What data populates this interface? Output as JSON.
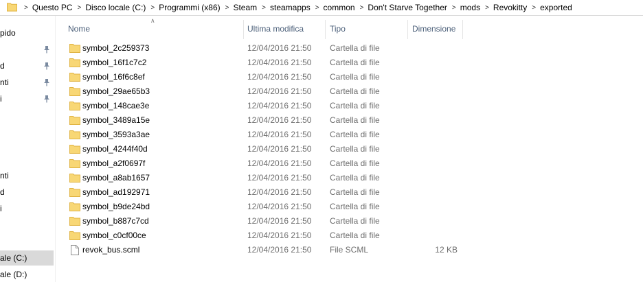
{
  "breadcrumb": [
    "Questo PC",
    "Disco locale (C:)",
    "Programmi (x86)",
    "Steam",
    "steamapps",
    "common",
    "Don't Starve Together",
    "mods",
    "Revokitty",
    "exported"
  ],
  "breadcrumb_separator": ">",
  "nav": {
    "items": [
      {
        "label": "pido",
        "pinned": false
      },
      {
        "label": "",
        "pinned": true
      },
      {
        "label": "d",
        "pinned": true
      },
      {
        "label": "nti",
        "pinned": true
      },
      {
        "label": "i",
        "pinned": true
      },
      {
        "label": "nti",
        "pinned": false
      },
      {
        "label": "d",
        "pinned": false
      },
      {
        "label": "i",
        "pinned": false
      },
      {
        "label": "ale (C:)",
        "pinned": false,
        "selected": true
      },
      {
        "label": "ale (D:)",
        "pinned": false
      }
    ]
  },
  "columns": {
    "name": "Nome",
    "modified": "Ultima modifica",
    "type": "Tipo",
    "size": "Dimensione"
  },
  "files": [
    {
      "name": "symbol_2c259373",
      "modified": "12/04/2016 21:50",
      "type": "Cartella di file",
      "size": "",
      "icon": "folder-icon"
    },
    {
      "name": "symbol_16f1c7c2",
      "modified": "12/04/2016 21:50",
      "type": "Cartella di file",
      "size": "",
      "icon": "folder-icon"
    },
    {
      "name": "symbol_16f6c8ef",
      "modified": "12/04/2016 21:50",
      "type": "Cartella di file",
      "size": "",
      "icon": "folder-icon"
    },
    {
      "name": "symbol_29ae65b3",
      "modified": "12/04/2016 21:50",
      "type": "Cartella di file",
      "size": "",
      "icon": "folder-icon"
    },
    {
      "name": "symbol_148cae3e",
      "modified": "12/04/2016 21:50",
      "type": "Cartella di file",
      "size": "",
      "icon": "folder-icon"
    },
    {
      "name": "symbol_3489a15e",
      "modified": "12/04/2016 21:50",
      "type": "Cartella di file",
      "size": "",
      "icon": "folder-icon"
    },
    {
      "name": "symbol_3593a3ae",
      "modified": "12/04/2016 21:50",
      "type": "Cartella di file",
      "size": "",
      "icon": "folder-icon"
    },
    {
      "name": "symbol_4244f40d",
      "modified": "12/04/2016 21:50",
      "type": "Cartella di file",
      "size": "",
      "icon": "folder-icon"
    },
    {
      "name": "symbol_a2f0697f",
      "modified": "12/04/2016 21:50",
      "type": "Cartella di file",
      "size": "",
      "icon": "folder-icon"
    },
    {
      "name": "symbol_a8ab1657",
      "modified": "12/04/2016 21:50",
      "type": "Cartella di file",
      "size": "",
      "icon": "folder-icon"
    },
    {
      "name": "symbol_ad192971",
      "modified": "12/04/2016 21:50",
      "type": "Cartella di file",
      "size": "",
      "icon": "folder-icon"
    },
    {
      "name": "symbol_b9de24bd",
      "modified": "12/04/2016 21:50",
      "type": "Cartella di file",
      "size": "",
      "icon": "folder-icon"
    },
    {
      "name": "symbol_b887c7cd",
      "modified": "12/04/2016 21:50",
      "type": "Cartella di file",
      "size": "",
      "icon": "folder-icon"
    },
    {
      "name": "symbol_c0cf00ce",
      "modified": "12/04/2016 21:50",
      "type": "Cartella di file",
      "size": "",
      "icon": "folder-icon"
    },
    {
      "name": "revok_bus.scml",
      "modified": "12/04/2016 21:50",
      "type": "File SCML",
      "size": "12 KB",
      "icon": "file-icon"
    }
  ],
  "colors": {
    "header_text": "#4c607a",
    "secondary_text": "#6d6d6d",
    "folder_fill": "#f8d775",
    "folder_edge": "#e0b342",
    "nav_selected": "#d9d9d9"
  }
}
